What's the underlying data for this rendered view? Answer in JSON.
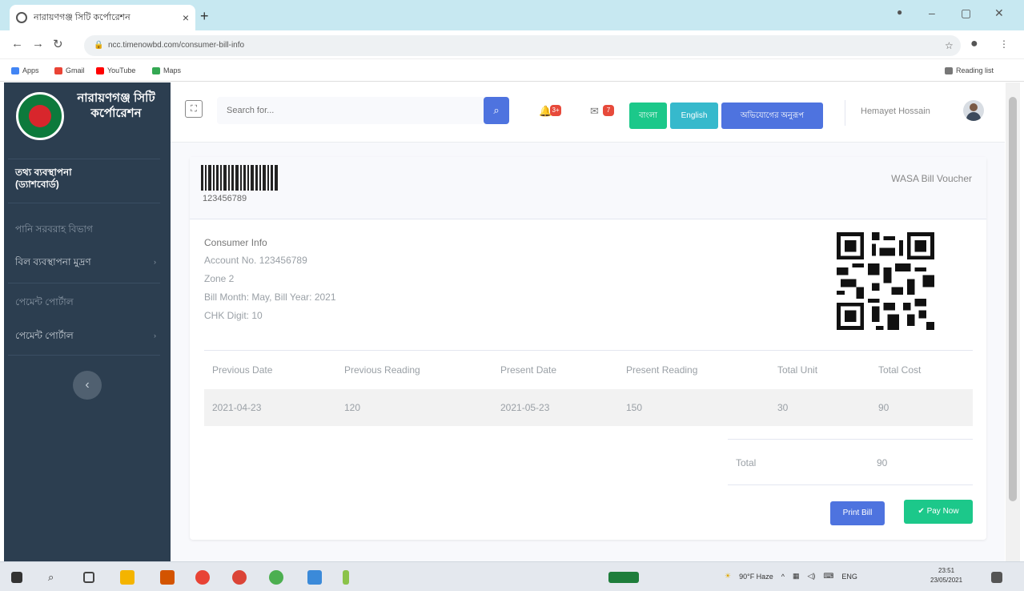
{
  "browser": {
    "tab_title": "নারায়ণগঞ্জ সিটি কর্পোরেশন",
    "url": "ncc.timenowbd.com/consumer-bill-info",
    "bookmarks": [
      "Apps",
      "Gmail",
      "YouTube",
      "Maps"
    ],
    "reading_list": "Reading list"
  },
  "sidebar": {
    "brand": "নারায়ণগঞ্জ সিটি কর্পোরেশন",
    "items": [
      {
        "label": "তথ্য ব্যবস্থাপনা (ড্যাশবোর্ড)"
      },
      {
        "label": "পানি সরবরাহ বিভাগ"
      },
      {
        "label": "বিল ব্যবস্থাপনা মুদ্রণ"
      },
      {
        "label": "পেমেন্ট পোর্টাল"
      },
      {
        "label": "পেমেন্ট পোর্টাল"
      }
    ]
  },
  "topbar": {
    "search_placeholder": "Search for...",
    "alerts_count": "3+",
    "messages_count": "7",
    "btn_bangla": "বাংলা",
    "btn_english": "English",
    "btn_complaint": "অভিযোগের অনুরূপ",
    "user_name": "Hemayet Hossain"
  },
  "voucher": {
    "barcode_number": "123456789",
    "title": "WASA Bill Voucher",
    "consumer_info": {
      "heading": "Consumer Info",
      "account": "Account No. 123456789",
      "zone": "Zone 2",
      "bill_month": "Bill Month: May, Bill Year: 2021",
      "chk_digit": "CHK Digit: 10"
    },
    "table": {
      "headers": [
        "Previous Date",
        "Previous Reading",
        "Present Date",
        "Present Reading",
        "Total Unit",
        "Total Cost"
      ],
      "rows": [
        [
          "2021-04-23",
          "120",
          "2021-05-23",
          "150",
          "30",
          "90"
        ]
      ]
    },
    "total_label": "Total",
    "total_value": "90",
    "print_label": "Print Bill",
    "pay_label": "✔ Pay Now"
  },
  "taskbar": {
    "weather": "90°F Haze",
    "lang": "ENG",
    "time": "23:51",
    "date": "23/05/2021"
  }
}
